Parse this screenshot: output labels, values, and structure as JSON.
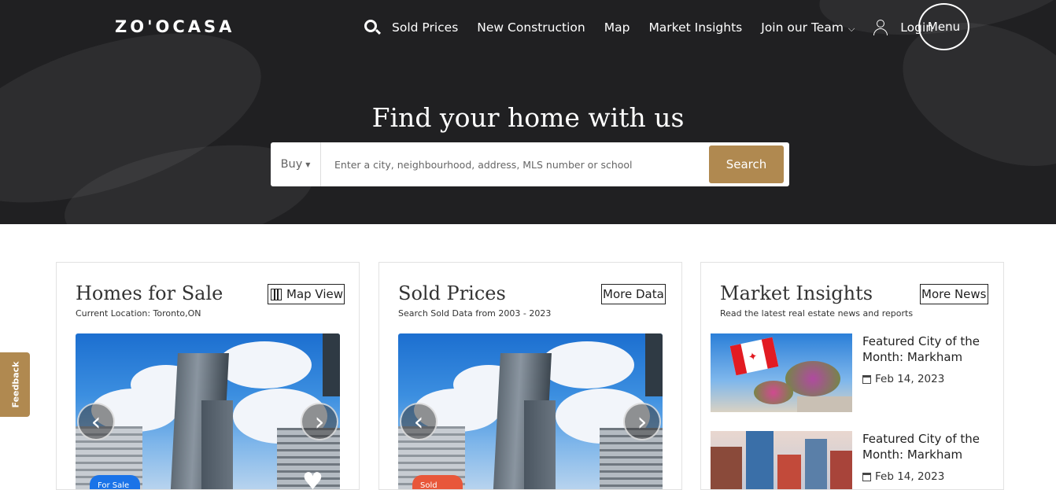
{
  "header": {
    "logo": "ZO'OCASA",
    "nav": [
      "Sold Prices",
      "New Construction",
      "Map",
      "Market Insights",
      "Join our Team"
    ],
    "login": "Login",
    "menu": "Menu"
  },
  "hero": {
    "title": "Find your home with us",
    "search": {
      "mode": "Buy",
      "placeholder": "Enter a city, neighbourhood, address, MLS number or school",
      "button": "Search"
    }
  },
  "cards": {
    "homes": {
      "title": "Homes for Sale",
      "subtitle": "Current Location: Toronto,ON",
      "button": "Map View",
      "badge": "For Sale"
    },
    "sold": {
      "title": "Sold Prices",
      "subtitle": "Search Sold Data from 2003 - 2023",
      "button": "More Data",
      "badge": "Sold"
    },
    "insights": {
      "title": "Market Insights",
      "subtitle": "Read the latest real estate news and reports",
      "button": "More News",
      "articles": [
        {
          "title": "Featured City of the Month: Markham",
          "date": "Feb 14, 2023"
        },
        {
          "title": "Featured City of the Month: Markham",
          "date": "Feb 14, 2023"
        }
      ]
    }
  },
  "feedback": "Feedback",
  "colors": {
    "accent": "#b08950",
    "hero_bg": "#202022",
    "for_sale_badge": "#1a73e8",
    "sold_badge": "#e8573a"
  }
}
